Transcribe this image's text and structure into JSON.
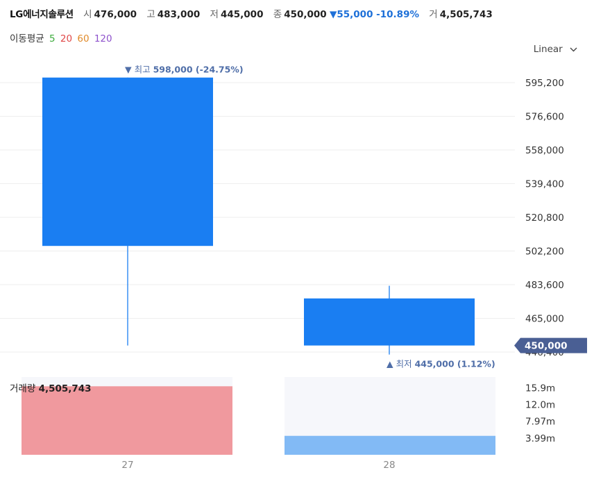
{
  "header": {
    "name": "LG에너지솔루션",
    "open_label": "시",
    "open": "476,000",
    "high_label": "고",
    "high": "483,000",
    "low_label": "저",
    "low": "445,000",
    "close_label": "종",
    "close": "450,000",
    "change": "▼55,000 -10.89%",
    "volume_label": "거",
    "volume": "4,505,743"
  },
  "moving_average": {
    "label": "이동평균",
    "periods": [
      {
        "value": "5",
        "color": "#3bab3b"
      },
      {
        "value": "20",
        "color": "#e04848"
      },
      {
        "value": "60",
        "color": "#e08a2a"
      },
      {
        "value": "120",
        "color": "#8e52cc"
      }
    ]
  },
  "scale_selector": {
    "label": "Linear"
  },
  "colors": {
    "up": "#f0999e",
    "down": "#1a7ef2",
    "down_volume": "#82baf5",
    "annotation": "#4f6ea8",
    "current_price": "#4a5f94"
  },
  "chart_data": [
    {
      "type": "candlestick",
      "categories": [
        "27",
        "28"
      ],
      "candles": [
        {
          "x": "27",
          "open": 598000,
          "high": 598000,
          "low": 450000,
          "close": 505000
        },
        {
          "x": "28",
          "open": 476000,
          "high": 483000,
          "low": 445000,
          "close": 450000
        }
      ],
      "ylim": [
        440000,
        600000
      ],
      "y_ticks": [
        "595,200",
        "576,600",
        "558,000",
        "539,400",
        "520,800",
        "502,200",
        "483,600",
        "465,000",
        "446,400"
      ],
      "y_tick_values": [
        595200,
        576600,
        558000,
        539400,
        520800,
        502200,
        483600,
        465000,
        446400
      ],
      "grid": true,
      "annotations": {
        "high": {
          "marker": "▼",
          "label": "최고",
          "value": "598,000 (-24.75%)",
          "x": "27",
          "y": 598000
        },
        "low": {
          "marker": "▲",
          "label": "최저",
          "value": "445,000 (1.12%)",
          "x": "28",
          "y": 445000
        }
      },
      "current_price": {
        "label": "450,000",
        "value": 450000
      }
    },
    {
      "type": "bar",
      "title": "거래량",
      "title_value": "4,505,743",
      "categories": [
        "27",
        "28"
      ],
      "values": [
        16300000,
        4505743
      ],
      "directions": [
        "up",
        "down"
      ],
      "ylim": [
        0,
        18500000
      ],
      "y_ticks": [
        "15.9m",
        "12.0m",
        "7.97m",
        "3.99m"
      ],
      "y_tick_values": [
        15900000,
        12000000,
        7970000,
        3990000
      ]
    }
  ]
}
